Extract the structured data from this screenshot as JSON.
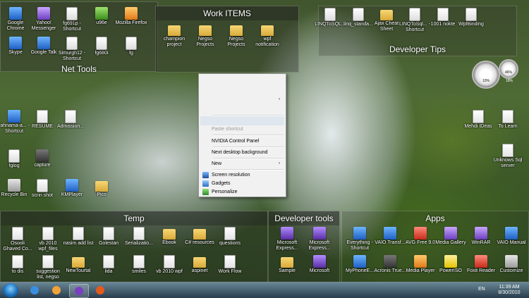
{
  "desktop": {
    "loose_icons": [
      {
        "label": "Google Chrome",
        "glyph": "g-blue"
      },
      {
        "label": "Yahoo! Messenger",
        "glyph": "g-purple"
      },
      {
        "label": "fg691p - Shortcut",
        "glyph": "g-sc"
      },
      {
        "label": "u96e",
        "glyph": "g-green"
      },
      {
        "label": "Mozilla Firefox",
        "glyph": "g-orange"
      },
      {
        "label": "Skype",
        "glyph": "g-blue"
      },
      {
        "label": "Google Talk",
        "glyph": "g-blue"
      },
      {
        "label": "Simurgh12 - Shortcut",
        "glyph": "g-sc"
      },
      {
        "label": "fg680i",
        "glyph": "g-sc"
      },
      {
        "label": "fg",
        "glyph": "g-sc"
      }
    ],
    "left_icons": [
      {
        "label": "rahnama-a... - Shortcut",
        "glyph": "g-blue"
      },
      {
        "label": "RESUME",
        "glyph": "g-doc"
      },
      {
        "label": "Admission...",
        "glyph": "g-doc"
      },
      {
        "label": "fglog",
        "glyph": "g-sc"
      },
      {
        "label": "capture",
        "glyph": "g-dark"
      },
      {
        "label": "Recycle Bin",
        "glyph": "g-gray"
      },
      {
        "label": "scrin shot",
        "glyph": "g-sc"
      },
      {
        "label": "KMPlayer",
        "glyph": "g-blue"
      },
      {
        "label": "Pics",
        "glyph": "g-folder"
      }
    ],
    "right_icons": [
      {
        "label": "Mehdi IDeas",
        "glyph": "g-doc"
      },
      {
        "label": "To Learn",
        "glyph": "g-doc"
      },
      {
        "label": "Unknows Sql server",
        "glyph": "g-doc"
      }
    ]
  },
  "fences": {
    "net_tools": {
      "title": "Net Tools"
    },
    "work_items": {
      "title": "Work ITEMS",
      "items": [
        {
          "label": "champion project",
          "glyph": "g-folder"
        },
        {
          "label": "Negso Projects",
          "glyph": "g-folder"
        },
        {
          "label": "Negso Projects",
          "glyph": "g-folder"
        },
        {
          "label": "wpf notification",
          "glyph": "g-folder"
        }
      ]
    },
    "developer_tips": {
      "title": "Developer Tips",
      "items": [
        {
          "label": "LINQToSQL...",
          "glyph": "g-sc"
        },
        {
          "label": "linq_standa...",
          "glyph": "g-sc"
        },
        {
          "label": "Ajax Cheat Sheet",
          "glyph": "g-folder"
        },
        {
          "label": "LINQToSql... - Shortcut",
          "glyph": "g-sc"
        },
        {
          "label": "1001 nokte",
          "glyph": "g-doc"
        },
        {
          "label": "WpfBinding",
          "glyph": "g-sc"
        }
      ]
    },
    "temp": {
      "title": "Temp",
      "items": [
        {
          "label": "Osooli Ghaved Co...",
          "glyph": "g-doc"
        },
        {
          "label": "vb 2010 wpf_files",
          "glyph": "g-doc"
        },
        {
          "label": "nasim add list",
          "glyph": "g-doc"
        },
        {
          "label": "Golestan",
          "glyph": "g-doc"
        },
        {
          "label": "Serializatio...",
          "glyph": "g-doc"
        },
        {
          "label": "Ebook",
          "glyph": "g-folder"
        },
        {
          "label": "C# resources",
          "glyph": "g-folder"
        },
        {
          "label": "questions",
          "glyph": "g-doc"
        },
        {
          "label": "to dis",
          "glyph": "g-doc"
        },
        {
          "label": "suggestion list, negso",
          "glyph": "g-doc"
        },
        {
          "label": "NewTourtal",
          "glyph": "g-folder"
        },
        {
          "label": "lida",
          "glyph": "g-doc"
        },
        {
          "label": "smiles",
          "glyph": "g-doc"
        },
        {
          "label": "vb 2010 wpf",
          "glyph": "g-doc"
        },
        {
          "label": "aspinet",
          "glyph": "g-folder"
        },
        {
          "label": "Work Flow",
          "glyph": "g-doc"
        }
      ]
    },
    "developer_tools": {
      "title": "Developer tools",
      "items": [
        {
          "label": "Microsoft Express...",
          "glyph": "g-vs"
        },
        {
          "label": "Microsoft Express...",
          "glyph": "g-vs"
        },
        {
          "label": "Sample",
          "glyph": "g-folder"
        },
        {
          "label": "Microsoft",
          "glyph": "g-vs"
        }
      ]
    },
    "apps": {
      "title": "Apps",
      "items": [
        {
          "label": "Everything - Shortcut",
          "glyph": "g-blue"
        },
        {
          "label": "VAIO Transf...",
          "glyph": "g-blue"
        },
        {
          "label": "AVG Free 9.0",
          "glyph": "g-red"
        },
        {
          "label": "Media Gallery",
          "glyph": "g-purple"
        },
        {
          "label": "WinRAR",
          "glyph": "g-purple"
        },
        {
          "label": "VAIO Manual",
          "glyph": "g-blue"
        },
        {
          "label": "MyPhoneE...",
          "glyph": "g-blue"
        },
        {
          "label": "Acronis True...",
          "glyph": "g-dark"
        },
        {
          "label": "Media Player",
          "glyph": "g-orange"
        },
        {
          "label": "PowerISO",
          "glyph": "g-yellow"
        },
        {
          "label": "Foxit Reader",
          "glyph": "g-red"
        },
        {
          "label": "Customize",
          "glyph": "g-gray"
        }
      ]
    }
  },
  "context_menu": {
    "items": {
      "paste_shortcut": "Paste shortcut",
      "nvidia": "NVIDIA Control Panel",
      "next_bg": "Next desktop background",
      "new": "New",
      "screen_res": "Screen resolution",
      "gadgets": "Gadgets",
      "personalize": "Personalize"
    },
    "arrow": "›"
  },
  "gadget": {
    "values": [
      "10%",
      "46%",
      "18%"
    ]
  },
  "taskbar": {
    "language": "EN",
    "time": "11:39 AM",
    "date": "8/30/2010",
    "pinned": [
      {
        "name": "internet-explorer-icon",
        "color": "#3b8fe0"
      },
      {
        "name": "media-player-icon",
        "color": "#f2a23a"
      },
      {
        "name": "yahoo-messenger-icon",
        "color": "#7b3fc1"
      },
      {
        "name": "firefox-icon",
        "color": "#e25b1a"
      }
    ]
  }
}
